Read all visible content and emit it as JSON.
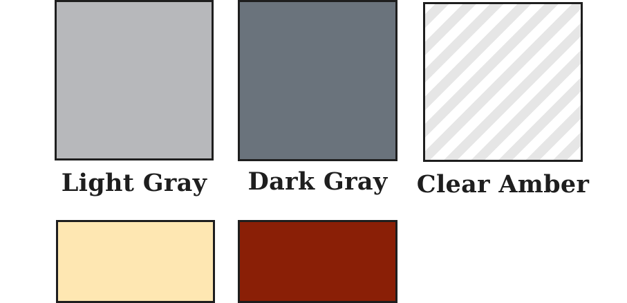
{
  "swatches": [
    {
      "label": "Light Gray",
      "color": "#b7b8bb",
      "pattern": "solid"
    },
    {
      "label": "Dark Gray",
      "color": "#6a737c",
      "pattern": "solid"
    },
    {
      "label": "Clear Amber",
      "color": "#ffffff",
      "pattern": "diagonal-stripes",
      "stripe_color": "#e6e6e6"
    },
    {
      "label": "",
      "color": "#fee7b2",
      "pattern": "solid"
    },
    {
      "label": "",
      "color": "#8a1f06",
      "pattern": "solid"
    }
  ],
  "border_color": "#1e1e1e"
}
